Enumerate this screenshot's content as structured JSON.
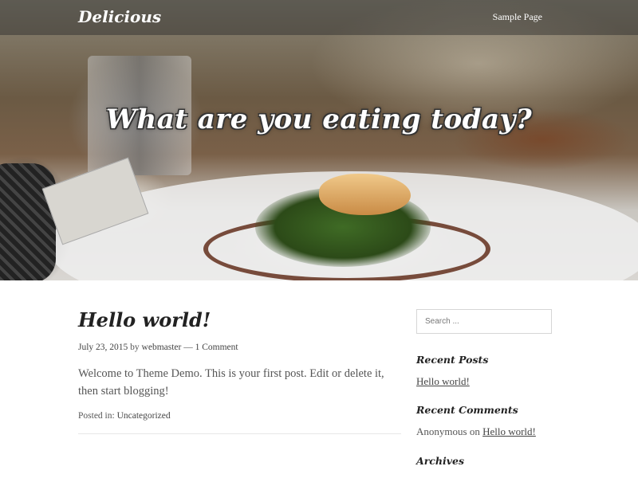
{
  "header": {
    "site_title": "Delicious",
    "nav": [
      {
        "label": "Sample Page"
      }
    ]
  },
  "hero": {
    "tagline": "What are you eating today?"
  },
  "post": {
    "title": "Hello world!",
    "date": "July 23, 2015",
    "by": "by",
    "author": "webmaster",
    "separator": "—",
    "comments": "1 Comment",
    "body": "Welcome to Theme Demo. This is your first post. Edit or delete it, then start blogging!",
    "posted_in_label": "Posted in:",
    "category": "Uncategorized"
  },
  "sidebar": {
    "search_placeholder": "Search ...",
    "recent_posts": {
      "title": "Recent Posts",
      "items": [
        {
          "label": "Hello world!"
        }
      ]
    },
    "recent_comments": {
      "title": "Recent Comments",
      "items": [
        {
          "author": "Anonymous",
          "on": "on",
          "post": "Hello world!"
        }
      ]
    },
    "archives": {
      "title": "Archives"
    }
  },
  "colors": {
    "accent_text": "#222222",
    "body_text": "#555555",
    "header_bar": "#282828"
  }
}
